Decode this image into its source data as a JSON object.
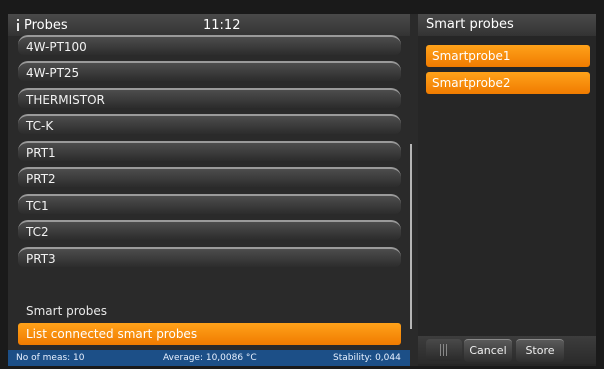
{
  "left_panel": {
    "title": "Probes",
    "time": "11:12",
    "probes": [
      "4W-PT100",
      "4W-PT25",
      "THERMISTOR",
      "TC-K",
      "PRT1",
      "PRT2",
      "TC1",
      "TC2",
      "PRT3"
    ],
    "section_label": "Smart probes",
    "action_label": "List connected smart probes"
  },
  "status": {
    "meas": "No of meas: 10",
    "average": "Average: 10,0086 °C",
    "stability": "Stability: 0,044"
  },
  "right_panel": {
    "title": "Smart probes",
    "items": [
      "Smartprobe1",
      "Smartprobe2"
    ],
    "cancel_label": "Cancel",
    "store_label": "Store"
  },
  "colors": {
    "accent": "#f7900c",
    "statusbar": "#1c4f87",
    "background": "#2a2a2a"
  },
  "icons": {
    "title_icon": "info-icon",
    "grip": "grip-icon"
  }
}
